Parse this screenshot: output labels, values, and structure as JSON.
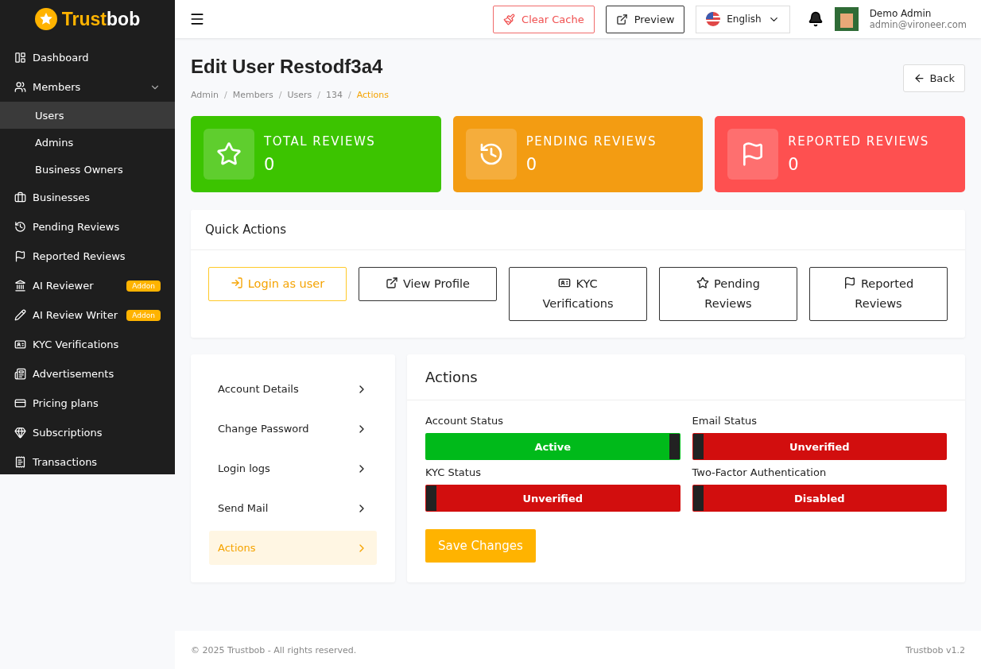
{
  "brand": {
    "part_1": "Trust",
    "part_2": "bob"
  },
  "sidebar": {
    "items": [
      {
        "label": "Dashboard",
        "selected": false
      },
      {
        "label": "Members",
        "selected": false,
        "expanded": true,
        "children": [
          {
            "label": "Users",
            "selected": true
          },
          {
            "label": "Admins",
            "selected": false
          },
          {
            "label": "Business Owners",
            "selected": false
          }
        ]
      },
      {
        "label": "Businesses",
        "selected": false
      },
      {
        "label": "Pending Reviews",
        "selected": false
      },
      {
        "label": "Reported Reviews",
        "selected": false
      },
      {
        "label": "AI Reviewer",
        "selected": false,
        "badge": "Addon"
      },
      {
        "label": "AI Review Writer",
        "selected": false,
        "badge": "Addon"
      },
      {
        "label": "KYC Verifications",
        "selected": false
      },
      {
        "label": "Advertisements",
        "selected": false
      },
      {
        "label": "Pricing plans",
        "selected": false
      },
      {
        "label": "Subscriptions",
        "selected": false
      },
      {
        "label": "Transactions",
        "selected": false
      }
    ]
  },
  "topbar": {
    "clear_cache": "Clear Cache",
    "preview": "Preview",
    "language": "English",
    "user": {
      "name": "Demo Admin",
      "email": "admin@vironeer.com"
    }
  },
  "page": {
    "title": "Edit User Restodf3a4",
    "back": "Back",
    "breadcrumb": [
      "Admin",
      "Members",
      "Users",
      "134",
      "Actions"
    ],
    "breadcrumb_separator": "/"
  },
  "stats": [
    {
      "label": "TOTAL REVIEWS",
      "value": "0",
      "color": "#3cc400"
    },
    {
      "label": "PENDING REVIEWS",
      "value": "0",
      "color": "#f39c12"
    },
    {
      "label": "REPORTED REVIEWS",
      "value": "0",
      "color": "#fe5050"
    }
  ],
  "quick_actions": {
    "title": "Quick Actions",
    "buttons": [
      "Login as user",
      "View Profile",
      "KYC Verifications",
      "Pending Reviews",
      "Reported Reviews"
    ]
  },
  "user_menu": [
    {
      "label": "Account Details",
      "selected": false
    },
    {
      "label": "Change Password",
      "selected": false
    },
    {
      "label": "Login logs",
      "selected": false
    },
    {
      "label": "Send Mail",
      "selected": false
    },
    {
      "label": "Actions",
      "selected": true
    }
  ],
  "actions": {
    "title": "Actions",
    "toggles": [
      {
        "label": "Account Status",
        "text": "Active",
        "on": true
      },
      {
        "label": "Email Status",
        "text": "Unverified",
        "on": false
      },
      {
        "label": "KYC Status",
        "text": "Unverified",
        "on": false
      },
      {
        "label": "Two-Factor Authentication",
        "text": "Disabled",
        "on": false
      }
    ],
    "save": "Save Changes"
  },
  "footer": {
    "copyright": "© 2025 Trustbob - All rights reserved.",
    "version": "Trustbob v1.2"
  }
}
